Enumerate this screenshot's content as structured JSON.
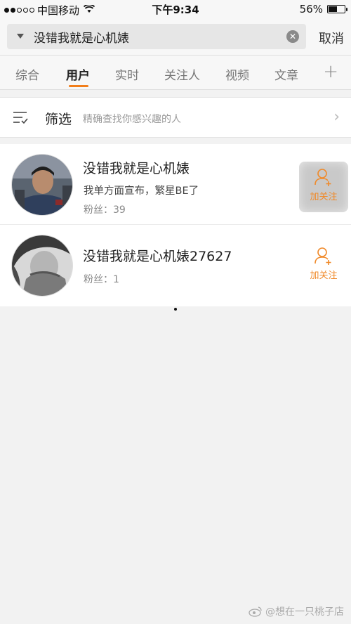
{
  "status_bar": {
    "carrier": "中国移动",
    "time": "下午9:34",
    "battery": "56%",
    "battery_level": 0.56
  },
  "search": {
    "query": "没错我就是心机婊",
    "cancel_label": "取消"
  },
  "tabs": [
    {
      "label": "综合",
      "active": false
    },
    {
      "label": "用户",
      "active": true
    },
    {
      "label": "实时",
      "active": false
    },
    {
      "label": "关注人",
      "active": false
    },
    {
      "label": "视频",
      "active": false
    },
    {
      "label": "文章",
      "active": false
    }
  ],
  "filter": {
    "title": "筛选",
    "description": "精确查找你感兴趣的人"
  },
  "users": [
    {
      "name": "没错我就是心机婊",
      "bio": "我单方面宣布，繁星BE了",
      "fans": "粉丝：39",
      "follow_label": "加关注"
    },
    {
      "name": "没错我就是心机婊27627",
      "fans": "粉丝：1",
      "follow_label": "加关注"
    }
  ],
  "watermark": "@想在一只桃子店",
  "colors": {
    "accent": "#f27e1a",
    "follow": "#f08a2a"
  }
}
